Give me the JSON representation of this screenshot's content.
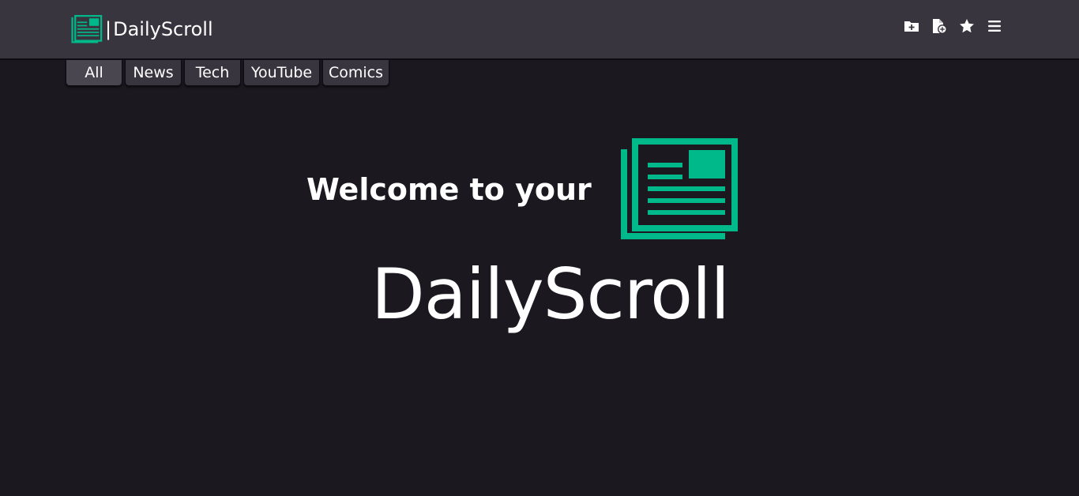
{
  "brand": {
    "name": "DailyScroll",
    "separator": "|",
    "accent_color": "#00b98a"
  },
  "header": {
    "actions": [
      {
        "icon": "folder-plus-icon"
      },
      {
        "icon": "file-plus-icon"
      },
      {
        "icon": "star-icon"
      },
      {
        "icon": "hamburger-menu-icon"
      }
    ]
  },
  "tabs": [
    {
      "label": "All",
      "active": true
    },
    {
      "label": "News",
      "active": false
    },
    {
      "label": "Tech",
      "active": false
    },
    {
      "label": "YouTube",
      "active": false
    },
    {
      "label": "Comics",
      "active": false
    }
  ],
  "hero": {
    "title": "Welcome to your",
    "brand": "DailyScroll",
    "icon": "newspaper-icon"
  }
}
